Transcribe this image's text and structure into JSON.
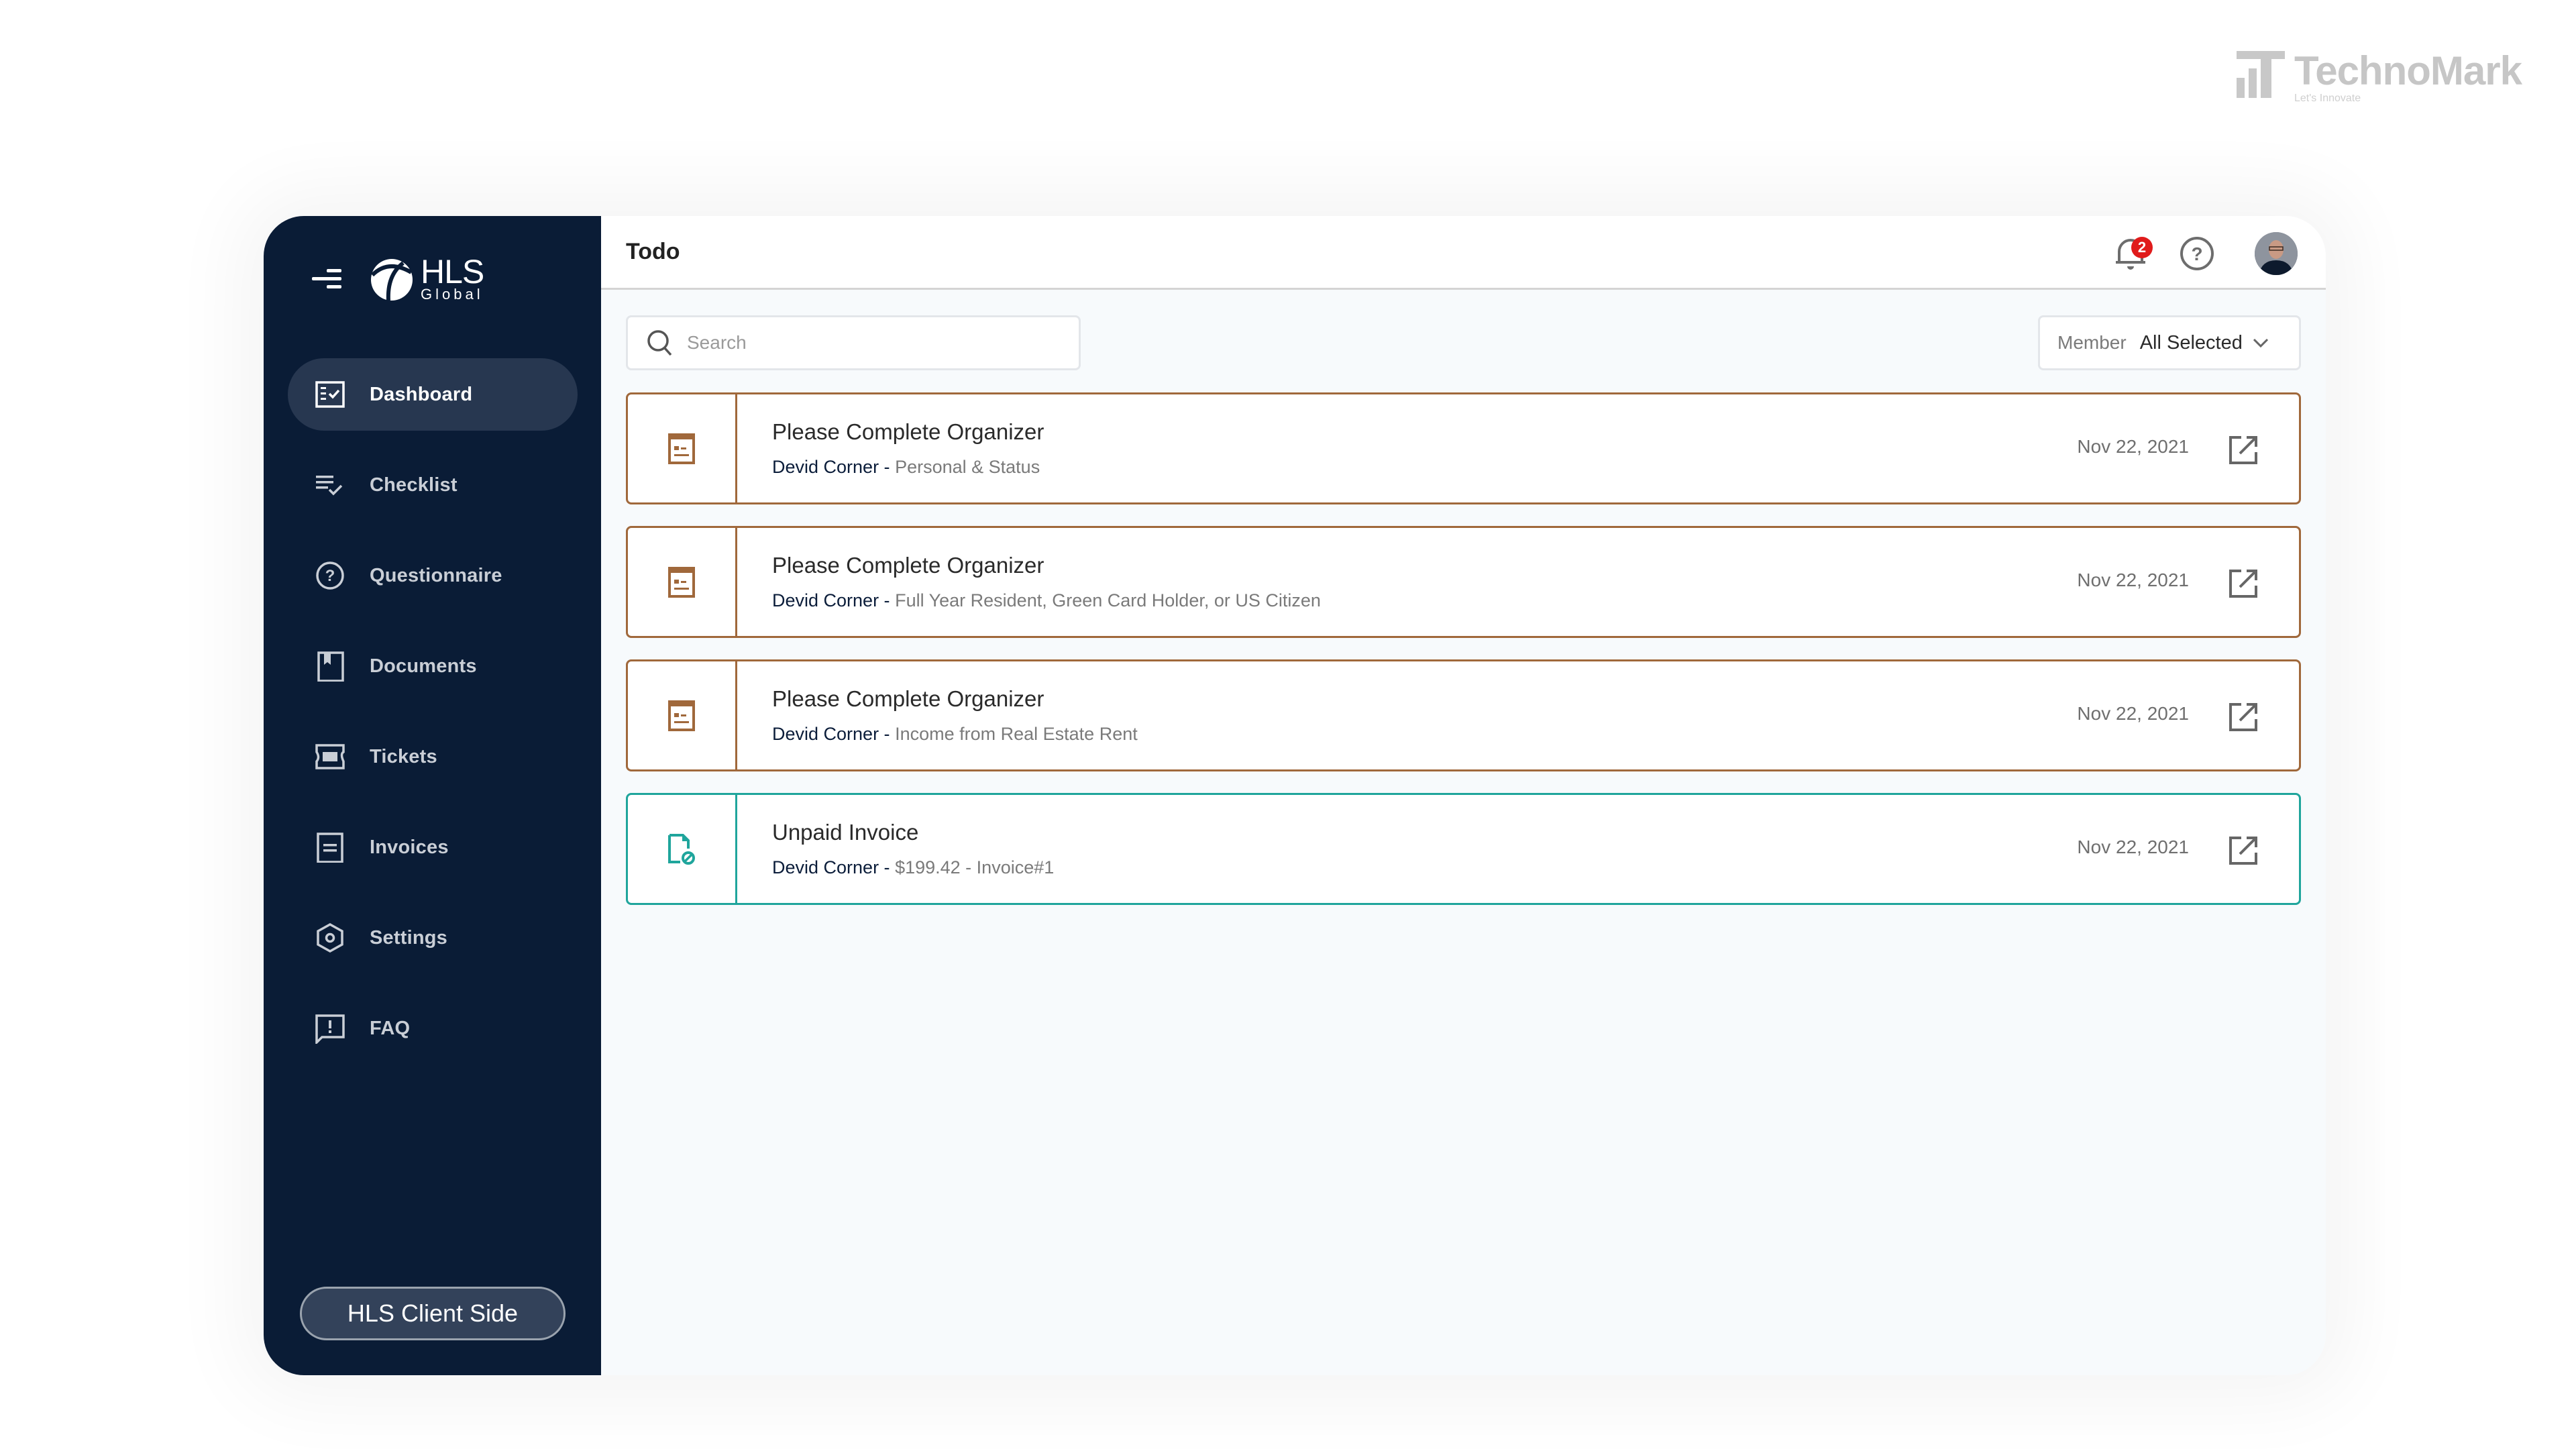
{
  "watermark": {
    "brand_name": "TechnoMark",
    "tagline": "Let's Innovate"
  },
  "sidebar": {
    "logo": {
      "name": "HLS",
      "subname": "Global"
    },
    "items": [
      {
        "label": "Dashboard",
        "icon": "dashboard-icon",
        "active": true
      },
      {
        "label": "Checklist",
        "icon": "checklist-icon",
        "active": false
      },
      {
        "label": "Questionnaire",
        "icon": "question-circle-icon",
        "active": false
      },
      {
        "label": "Documents",
        "icon": "document-bookmark-icon",
        "active": false
      },
      {
        "label": "Tickets",
        "icon": "ticket-icon",
        "active": false
      },
      {
        "label": "Invoices",
        "icon": "invoice-icon",
        "active": false
      },
      {
        "label": "Settings",
        "icon": "settings-hex-icon",
        "active": false
      },
      {
        "label": "FAQ",
        "icon": "faq-alert-icon",
        "active": false
      }
    ],
    "client_button": "HLS Client Side"
  },
  "header": {
    "title": "Todo",
    "notification_count": "2"
  },
  "toolbar": {
    "search_placeholder": "Search",
    "search_value": "",
    "member_label": "Member",
    "member_value": "All Selected"
  },
  "todos": [
    {
      "type": "organizer",
      "title": "Please Complete Organizer",
      "person": "Devid Corner -",
      "detail": "Personal & Status",
      "date": "Nov 22, 2021"
    },
    {
      "type": "organizer",
      "title": "Please Complete Organizer",
      "person": "Devid Corner -",
      "detail": "Full Year Resident, Green Card Holder, or US Citizen",
      "date": "Nov 22, 2021"
    },
    {
      "type": "organizer",
      "title": "Please Complete Organizer",
      "person": "Devid Corner -",
      "detail": "Income from Real Estate Rent",
      "date": "Nov 22, 2021"
    },
    {
      "type": "invoice",
      "title": "Unpaid Invoice",
      "person": "Devid Corner -",
      "detail": "$199.42 - Invoice#1",
      "date": "Nov 22, 2021"
    }
  ],
  "colors": {
    "sidebar_bg": "#0a1c36",
    "sidebar_active": "#273750",
    "organizer_accent": "#a0683b",
    "invoice_accent": "#1fa59c",
    "badge": "#e01b1b"
  }
}
